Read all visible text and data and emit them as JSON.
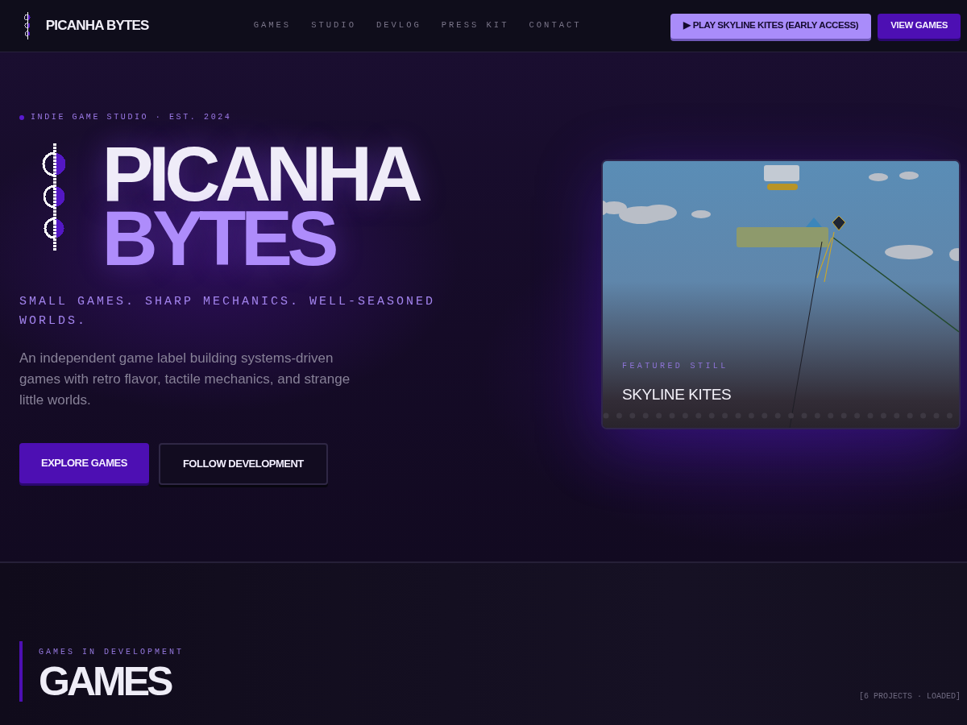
{
  "navbar": {
    "brand": "PICANHA BYTES",
    "links": [
      {
        "label": "GAMES"
      },
      {
        "label": "STUDIO"
      },
      {
        "label": "DEVLOG"
      },
      {
        "label": "PRESS KIT"
      },
      {
        "label": "CONTACT"
      }
    ],
    "buttons": [
      {
        "label": "▶ PLAY SKYLINE KITES (EARLY ACCESS)",
        "kind": "light"
      },
      {
        "label": "VIEW GAMES",
        "kind": "primary"
      }
    ]
  },
  "hero": {
    "eyebrow": "INDIE GAME STUDIO · EST. 2024",
    "title_lines": [
      "PICANHA",
      "BYTES"
    ],
    "tagline": "SMALL GAMES. SHARP MECHANICS. WELL-SEASONED WORLDS.",
    "description": "An independent game label building systems-driven games with retro flavor, tactile mechanics, and strange little worlds.",
    "buttons": [
      {
        "label": "EXPLORE GAMES",
        "kind": "primary"
      },
      {
        "label": "FOLLOW DEVELOPMENT",
        "kind": "outline"
      }
    ],
    "featured": {
      "eyebrow": "FEATURED STILL",
      "title": "SKYLINE KITES"
    }
  },
  "games_section": {
    "eyebrow": "GAMES IN DEVELOPMENT",
    "title": "GAMES",
    "status": "[6 PROJECTS · LOADED]"
  }
}
